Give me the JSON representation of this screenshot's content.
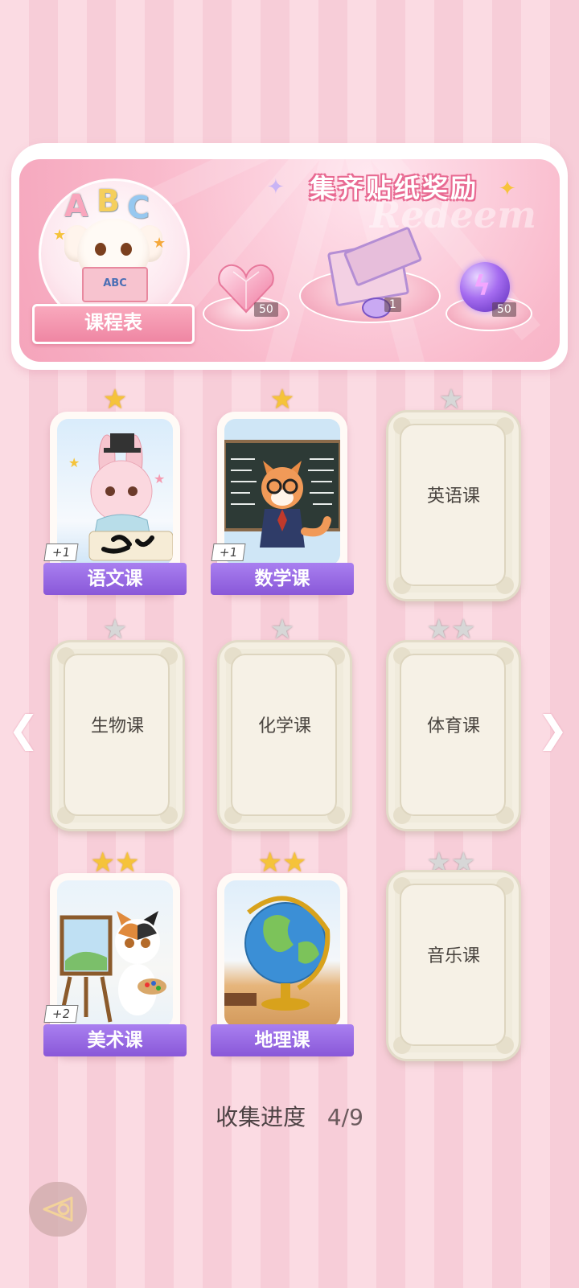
{
  "header": {
    "title": "集齐贴纸奖励",
    "watermark": "Redeem",
    "schedule_label": "课程表",
    "schedule_letters": [
      "A",
      "B",
      "C"
    ],
    "book_text": "ABC",
    "rewards": [
      {
        "icon": "heart-gem-icon",
        "count": "50"
      },
      {
        "icon": "gift-box-icon",
        "count": "1"
      },
      {
        "icon": "energy-orb-icon",
        "count": "50"
      }
    ]
  },
  "cards": [
    {
      "name": "语文课",
      "unlocked": true,
      "stars": 1,
      "star_color": "gold",
      "bonus": "+1"
    },
    {
      "name": "数学课",
      "unlocked": true,
      "stars": 1,
      "star_color": "gold",
      "bonus": "+1"
    },
    {
      "name": "英语课",
      "unlocked": false,
      "stars": 1,
      "star_color": "silver"
    },
    {
      "name": "生物课",
      "unlocked": false,
      "stars": 1,
      "star_color": "silver"
    },
    {
      "name": "化学课",
      "unlocked": false,
      "stars": 1,
      "star_color": "silver"
    },
    {
      "name": "体育课",
      "unlocked": false,
      "stars": 2,
      "star_color": "silver"
    },
    {
      "name": "美术课",
      "unlocked": true,
      "stars": 2,
      "star_color": "gold",
      "bonus": "+2"
    },
    {
      "name": "地理课",
      "unlocked": true,
      "stars": 2,
      "star_color": "gold"
    },
    {
      "name": "音乐课",
      "unlocked": false,
      "stars": 2,
      "star_color": "silver"
    }
  ],
  "progress": {
    "label": "收集进度",
    "value": "4/9"
  },
  "colors": {
    "accent_purple": "#8958d8",
    "pink_bg": "#fbdbe3",
    "gold_star": "#f5c33a"
  }
}
